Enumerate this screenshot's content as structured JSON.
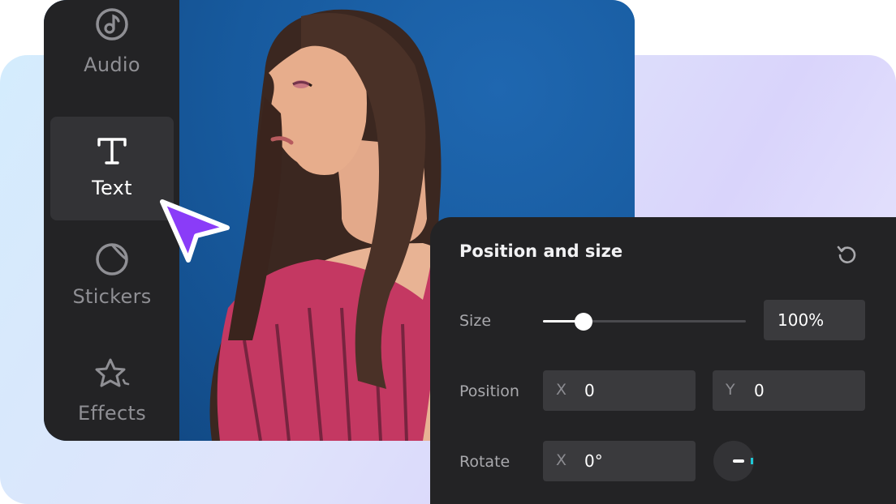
{
  "sidebar": {
    "items": [
      {
        "label": "Audio",
        "icon": "music-note-icon",
        "active": false
      },
      {
        "label": "Text",
        "icon": "text-t-icon",
        "active": true
      },
      {
        "label": "Stickers",
        "icon": "sticker-icon",
        "active": false
      },
      {
        "label": "Effects",
        "icon": "star-effects-icon",
        "active": false
      }
    ]
  },
  "canvas": {
    "background_color": "#17599f"
  },
  "panel": {
    "title": "Position and size",
    "reset_icon": "reset-icon",
    "size": {
      "label": "Size",
      "value": "100%",
      "slider_fraction": 0.2
    },
    "position": {
      "label": "Position",
      "x_axis": "X",
      "x_value": "0",
      "y_axis": "Y",
      "y_value": "0"
    },
    "rotate": {
      "label": "Rotate",
      "x_axis": "X",
      "x_value": "0°"
    }
  },
  "colors": {
    "accent_cursor": "#8a3cf8",
    "dial_tick": "#1fc8d6",
    "sidebar_bg": "#232325",
    "panel_bg": "#232325"
  }
}
